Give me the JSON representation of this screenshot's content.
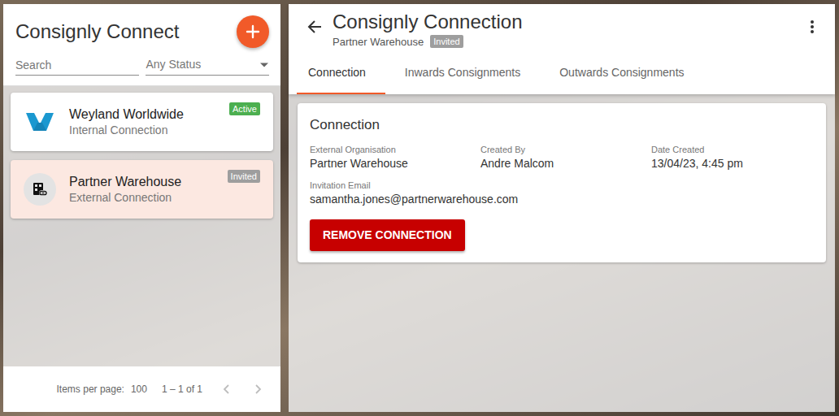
{
  "app": {
    "title": "Consignly Connect"
  },
  "filters": {
    "search_placeholder": "Search",
    "status": "Any Status"
  },
  "connections": [
    {
      "name": "Weyland Worldwide",
      "type": "Internal Connection",
      "status": "Active",
      "color": "#4caf50",
      "selected": false,
      "kind": "internal"
    },
    {
      "name": "Partner Warehouse",
      "type": "External Connection",
      "status": "Invited",
      "color": "#9e9e9e",
      "selected": true,
      "kind": "external"
    }
  ],
  "paginator": {
    "label": "Items per page:",
    "page_size": "100",
    "range": "1 – 1 of 1",
    "prev_disabled": true,
    "next_disabled": true
  },
  "detail": {
    "title": "Consignly Connection",
    "subtitle": "Partner Warehouse",
    "status": "Invited",
    "status_color": "#9e9e9e"
  },
  "tabs": [
    {
      "label": "Connection",
      "selected": true
    },
    {
      "label": "Inwards Consignments",
      "selected": false
    },
    {
      "label": "Outwards Consignments",
      "selected": false
    }
  ],
  "card": {
    "title": "Connection",
    "fields": [
      {
        "label": "External Organisation",
        "value": "Partner Warehouse"
      },
      {
        "label": "Created By",
        "value": "Andre Malcom"
      },
      {
        "label": "Date Created",
        "value": "13/04/23, 4:45 pm"
      },
      {
        "label": "Invitation Email",
        "value": "samantha.jones@partnerwarehouse.com"
      }
    ],
    "button": "REMOVE CONNECTION"
  }
}
